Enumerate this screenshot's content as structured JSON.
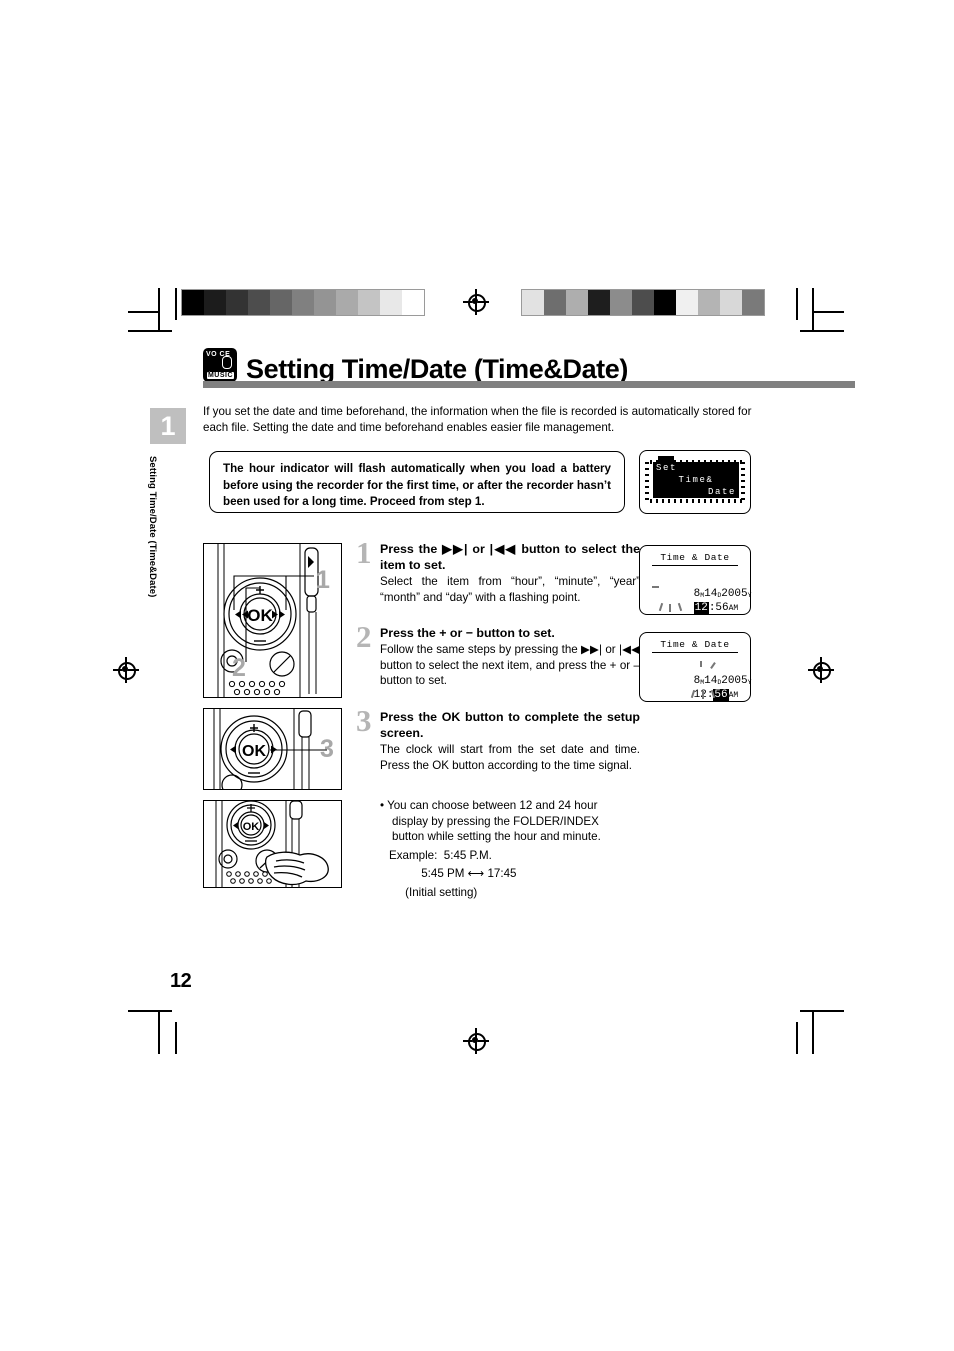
{
  "document": {
    "page_number": "12",
    "sidebar_label": "Setting Time/Date (Time&Date)",
    "chapter_number": "1"
  },
  "header": {
    "badge": {
      "line1": "VO CE",
      "line2": "MUSIC",
      "icon": "voice-music-badge-icon"
    },
    "title": "Setting Time/Date (Time&Date)"
  },
  "intro": {
    "text": "If you set the date and time beforehand, the information when the file is recorded is automatically stored for each file. Setting the date and time beforehand enables easier file management."
  },
  "note_box": {
    "text": "The hour indicator will flash automatically when you load a battery before using the recorder for the first time, or after the recorder hasn’t been used for a long time. Proceed from step 1."
  },
  "lcd_set_screen": {
    "line1": "Set",
    "line2": "Time&",
    "line3": "Date",
    "icon": "battery-icon"
  },
  "lcd_time_date_1": {
    "title": "Time & Date",
    "month": "8",
    "month_unit": "M",
    "day": "14",
    "day_unit": "D",
    "year": "2005",
    "year_unit": "Y",
    "hour": "12",
    "separator": ":",
    "minute": "56",
    "ampm": "AM",
    "flashing_field": "hour"
  },
  "lcd_time_date_2": {
    "title": "Time & Date",
    "month": "8",
    "month_unit": "M",
    "day": "14",
    "day_unit": "D",
    "year": "2005",
    "year_unit": "Y",
    "hour": "12",
    "separator": ":",
    "minute": "56",
    "ampm": "AM",
    "flashing_field": "minute"
  },
  "illustrations": [
    {
      "name": "recorder-control-pad-full",
      "callouts": [
        "1",
        "2"
      ]
    },
    {
      "name": "recorder-ok-button",
      "callouts": [
        "3"
      ]
    },
    {
      "name": "recorder-folder-index-button-press",
      "callouts": []
    }
  ],
  "steps": [
    {
      "number": "1",
      "heading": "Press the ▶▶| or |◀◀ button to select the item to set.",
      "body": "Select the item from “hour”, “minute”, “year” “month” and “day” with a flashing point."
    },
    {
      "number": "2",
      "heading": "Press the + or − button to set.",
      "body": "Follow the same steps by pressing the ▶▶| or |◀◀ button to select the next item, and press the + or – button to set."
    },
    {
      "number": "3",
      "heading": "Press the OK button to complete the setup screen.",
      "body": "The clock will start from the set date and time. Press the OK button according to the time signal."
    }
  ],
  "bullets": {
    "item1": "• You can choose between 12 and 24 hour display by pressing the FOLDER/INDEX button while setting the hour and minute.",
    "example_label": "Example:  5:45 P.M.",
    "example_line2": "          5:45 PM ⟷ 17:45",
    "example_line3": "     (Initial setting)"
  },
  "print_marks": {
    "swatch_left": [
      "#000000",
      "#1c1c1c",
      "#333333",
      "#4d4d4d",
      "#666666",
      "#808080",
      "#949494",
      "#aaaaaa",
      "#c4c4c4",
      "#e8e8e8",
      "#ffffff"
    ],
    "swatch_right": [
      "#e2e2e2",
      "#6e6e6e",
      "#aeaeae",
      "#1e1e1e",
      "#8c8c8c",
      "#4d4d4d",
      "#000000",
      "#f0f0f0",
      "#b4b4b4",
      "#d8d8d8",
      "#7a7a7a"
    ]
  }
}
